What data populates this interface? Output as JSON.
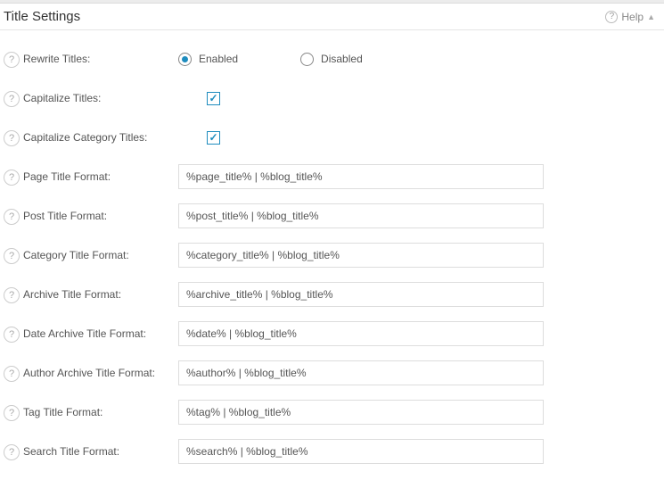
{
  "header": {
    "title": "Title Settings",
    "help_label": "Help"
  },
  "rows": {
    "rewrite": {
      "label": "Rewrite Titles:",
      "enabled_label": "Enabled",
      "disabled_label": "Disabled",
      "value": "enabled"
    },
    "capitalize_titles": {
      "label": "Capitalize Titles:",
      "checked": true
    },
    "capitalize_category": {
      "label": "Capitalize Category Titles:",
      "checked": true
    },
    "page_title": {
      "label": "Page Title Format:",
      "value": "%page_title% | %blog_title%"
    },
    "post_title": {
      "label": "Post Title Format:",
      "value": "%post_title% | %blog_title%"
    },
    "category_title": {
      "label": "Category Title Format:",
      "value": "%category_title% | %blog_title%"
    },
    "archive_title": {
      "label": "Archive Title Format:",
      "value": "%archive_title% | %blog_title%"
    },
    "date_archive_title": {
      "label": "Date Archive Title Format:",
      "value": "%date% | %blog_title%"
    },
    "author_archive_title": {
      "label": "Author Archive Title Format:",
      "value": "%author% | %blog_title%"
    },
    "tag_title": {
      "label": "Tag Title Format:",
      "value": "%tag% | %blog_title%"
    },
    "search_title": {
      "label": "Search Title Format:",
      "value": "%search% | %blog_title%"
    }
  }
}
